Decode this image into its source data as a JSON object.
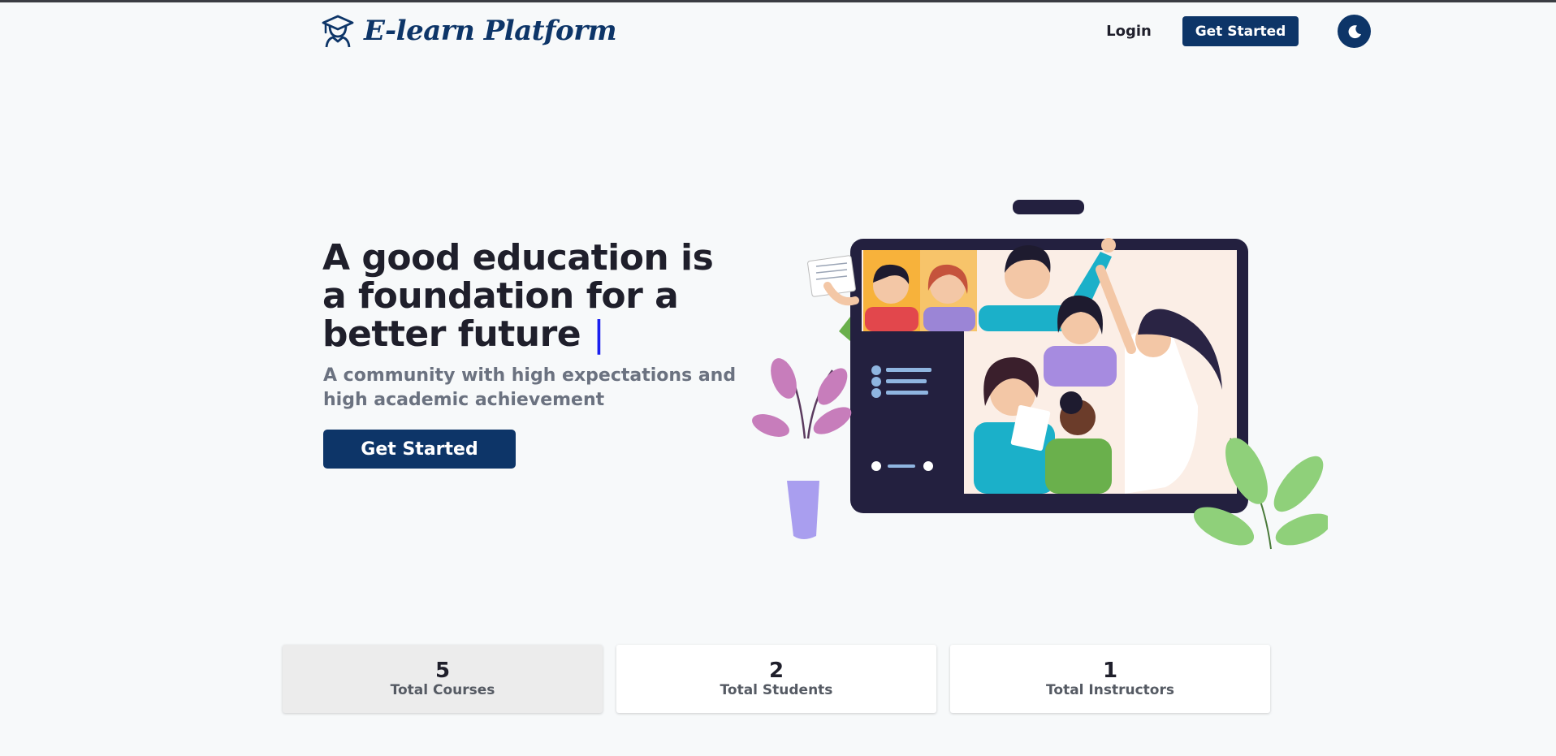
{
  "header": {
    "brand": "E-learn Platform",
    "login_label": "Login",
    "cta_label": "Get Started"
  },
  "hero": {
    "title": "A good education is a foundation for a better future",
    "cursor": "|",
    "subtitle": "A community with high expectations and high academic achievement",
    "cta_label": "Get Started"
  },
  "stats": [
    {
      "value": "5",
      "label": "Total Courses"
    },
    {
      "value": "2",
      "label": "Total Students"
    },
    {
      "value": "1",
      "label": "Total Instructors"
    }
  ],
  "icons": {
    "logo": "graduation-student-icon",
    "theme": "moon-icon"
  },
  "colors": {
    "brand": "#0d3568",
    "background": "#f7f9fa",
    "cursor": "#1b20f0",
    "text": "#1f1f2b",
    "muted": "#6b7280"
  }
}
